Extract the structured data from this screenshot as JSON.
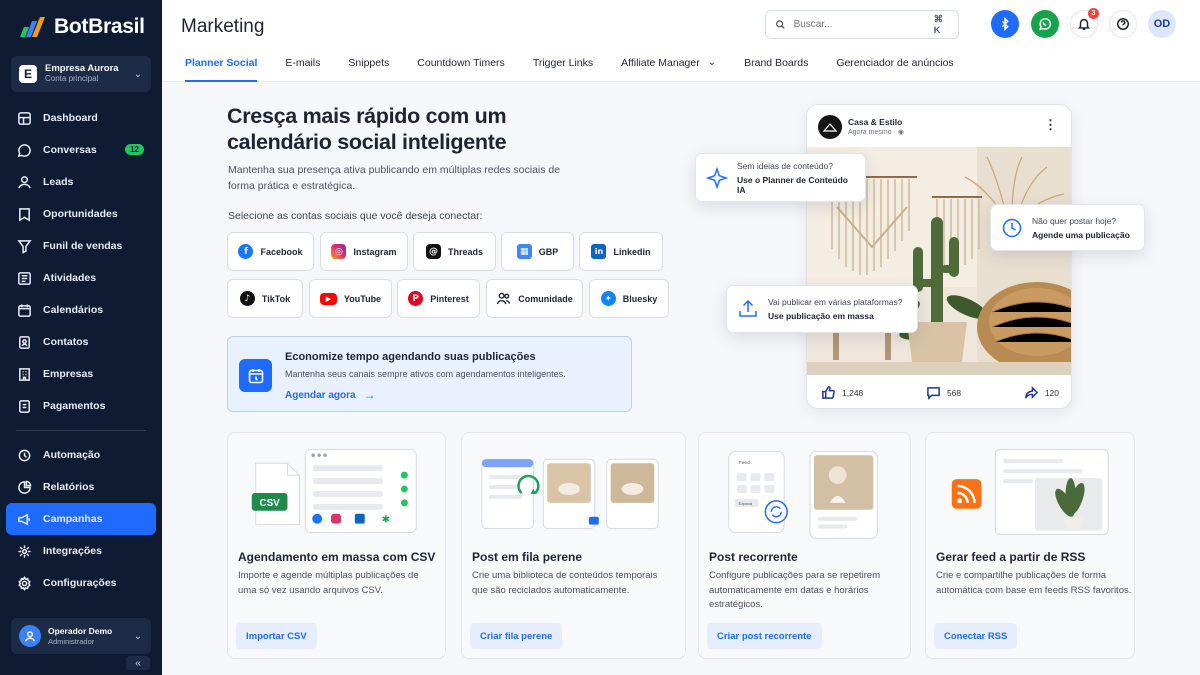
{
  "brand": {
    "name": "BotBrasil"
  },
  "account": {
    "initial": "E",
    "name": "Empresa Aurora",
    "subtitle": "Conta principal"
  },
  "sidebar": {
    "items": [
      {
        "label": "Dashboard",
        "icon": "dashboard-icon"
      },
      {
        "label": "Conversas",
        "icon": "chat-icon",
        "badge": "12"
      },
      {
        "label": "Leads",
        "icon": "user-icon"
      },
      {
        "label": "Oportunidades",
        "icon": "target-icon"
      },
      {
        "label": "Funil de vendas",
        "icon": "funnel-icon"
      },
      {
        "label": "Atividades",
        "icon": "activity-icon"
      },
      {
        "label": "Calendários",
        "icon": "calendar-icon"
      },
      {
        "label": "Contatos",
        "icon": "contacts-icon"
      },
      {
        "label": "Empresas",
        "icon": "building-icon"
      },
      {
        "label": "Pagamentos",
        "icon": "payment-icon"
      }
    ],
    "items2": [
      {
        "label": "Automação",
        "icon": "automation-icon"
      },
      {
        "label": "Relatórios",
        "icon": "reports-icon"
      },
      {
        "label": "Campanhas",
        "icon": "megaphone-icon",
        "active": true
      },
      {
        "label": "Integrações",
        "icon": "integrations-icon"
      },
      {
        "label": "Configurações",
        "icon": "settings-icon"
      }
    ],
    "active_color": "#1f6bff"
  },
  "user": {
    "name": "Operador Demo",
    "role": "Administrador"
  },
  "header": {
    "title": "Marketing",
    "search_placeholder": "Buscar...",
    "search_shortcut": "⌘ K",
    "notifications_count": "3",
    "avatar_initials": "OD"
  },
  "tabs": [
    {
      "label": "Planner Social",
      "active": true
    },
    {
      "label": "E-mails"
    },
    {
      "label": "Snippets"
    },
    {
      "label": "Countdown Timers"
    },
    {
      "label": "Trigger Links"
    },
    {
      "label": "Affiliate Manager",
      "dropdown": true
    },
    {
      "label": "Brand Boards"
    },
    {
      "label": "Gerenciador de anúncios"
    }
  ],
  "hero": {
    "title": "Cresça mais rápido com um calendário social inteligente",
    "subtitle": "Mantenha sua presença ativa publicando em múltiplas redes sociais de forma prática e estratégica.",
    "select_label": "Selecione as contas sociais que você deseja conectar:"
  },
  "social_accounts": [
    {
      "label": "Facebook",
      "color": "#1877f2",
      "glyph": "f"
    },
    {
      "label": "Instagram",
      "color": "#e1306c",
      "glyph": "◎"
    },
    {
      "label": "Threads",
      "color": "#111111",
      "glyph": "@"
    },
    {
      "label": "GBP",
      "color": "#4285f4",
      "glyph": "▦"
    },
    {
      "label": "Linkedin",
      "color": "#0a66c2",
      "glyph": "in"
    },
    {
      "label": "TikTok",
      "color": "#111111",
      "glyph": "♪"
    },
    {
      "label": "YouTube",
      "color": "#ff0000",
      "glyph": "▶"
    },
    {
      "label": "Pinterest",
      "color": "#e60023",
      "glyph": "P"
    },
    {
      "label": "Comunidade",
      "color": "#1f2433",
      "glyph": "👥"
    },
    {
      "label": "Bluesky",
      "color": "#1185fe",
      "glyph": "🦋"
    }
  ],
  "promo": {
    "title": "Economize tempo agendando suas publicações",
    "text": "Mantenha seus canais sempre ativos com agendamentos inteligentes.",
    "link": "Agendar agora"
  },
  "post_preview": {
    "account_name": "Casa & Estilo",
    "time": "Agora mesmo ·",
    "likes": "1,248",
    "comments": "568",
    "shares": "120"
  },
  "floating_cards": {
    "ideas": {
      "question": "Sem ideias de conteúdo?",
      "action": "Use o Planner de Conteúdo IA"
    },
    "schedule": {
      "question": "Não quer postar hoje?",
      "action": "Agende uma publicação"
    },
    "bulk": {
      "question": "Vai publicar em várias plataformas?",
      "action": "Use publicação em massa"
    }
  },
  "features": [
    {
      "title": "Agendamento em massa com CSV",
      "desc": "Importe e agende múltiplas publicações de uma só vez usando arquivos CSV.",
      "button": "Importar CSV",
      "badge": "CSV"
    },
    {
      "title": "Post em fila perene",
      "desc": "Crie uma biblioteca de conteúdos temporais que são reciclados automaticamente.",
      "button": "Criar fila perene"
    },
    {
      "title": "Post recorrente",
      "desc": "Configure publicações para se repetirem automaticamente em datas e horários estratégicos.",
      "button": "Criar post recorrente",
      "mini_label": "Feed",
      "mini_button": "Expand"
    },
    {
      "title": "Gerar feed a partir de RSS",
      "desc": "Crie e compartilhe publicações de forma automática com base em feeds RSS favoritos.",
      "button": "Conectar RSS"
    }
  ]
}
